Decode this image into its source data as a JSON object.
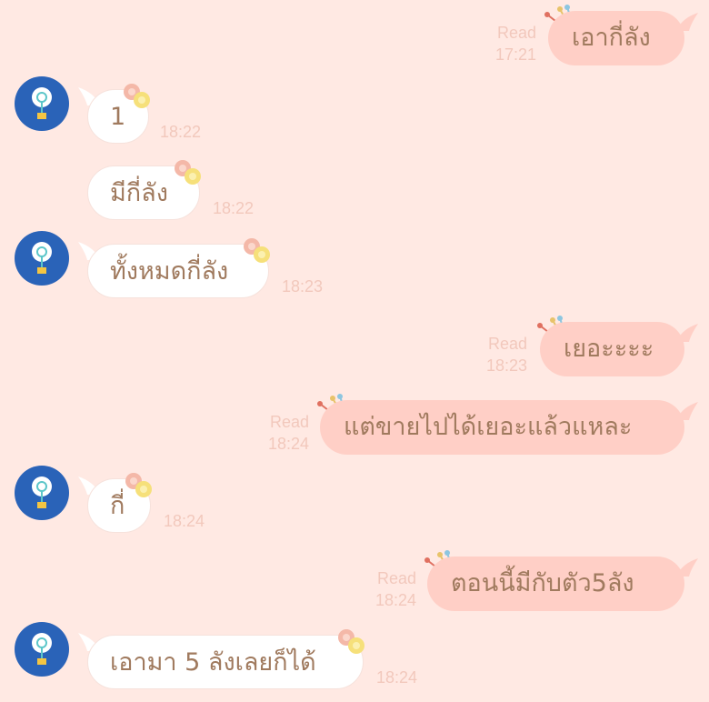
{
  "colors": {
    "background": "#ffe9e3",
    "incoming": "#ffffff",
    "outgoing": "#ffcfc6",
    "text": "#a07a5e",
    "meta": "#f2c8bc",
    "avatar": "#2a63b8"
  },
  "messages": [
    {
      "side": "out",
      "text": "เอากี่ลัง",
      "read": "Read",
      "time": "17:21"
    },
    {
      "side": "in",
      "text": "1",
      "time": "18:22",
      "avatar": true
    },
    {
      "side": "in",
      "text": "มีกี่ลัง",
      "time": "18:22",
      "avatar": false
    },
    {
      "side": "in",
      "text": "ทั้งหมดกี่ลัง",
      "time": "18:23",
      "avatar": true
    },
    {
      "side": "out",
      "text": "เยอะะะะ",
      "read": "Read",
      "time": "18:23"
    },
    {
      "side": "out",
      "text": "แต่ขายไปได้เยอะแล้วแหละ",
      "read": "Read",
      "time": "18:24"
    },
    {
      "side": "in",
      "text": "กี่",
      "time": "18:24",
      "avatar": true
    },
    {
      "side": "out",
      "text": "ตอนนี้มีกับตัว5ลัง",
      "read": "Read",
      "time": "18:24"
    },
    {
      "side": "in",
      "text": "เอามา 5 ลังเลยก็ได้",
      "time": "18:24",
      "avatar": true
    }
  ]
}
